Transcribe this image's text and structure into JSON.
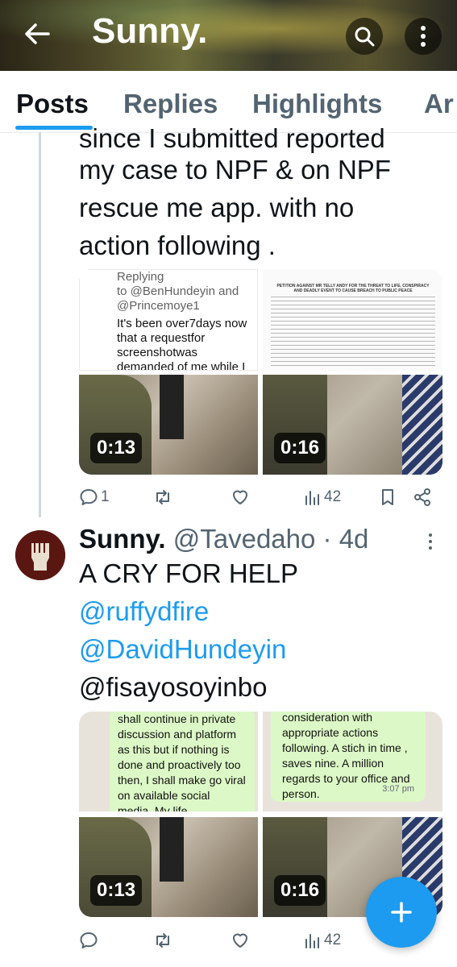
{
  "header": {
    "title": "Sunny."
  },
  "tabs": [
    {
      "label": "Posts",
      "active": true
    },
    {
      "label": "Replies"
    },
    {
      "label": "Highlights"
    },
    {
      "label": "Ar"
    }
  ],
  "post1": {
    "text_lines": [
      "since I submitted reported",
      "my case to NPF & on NPF",
      "rescue me app. with no",
      "action following ."
    ],
    "doc1": {
      "lines": [
        "Replying",
        "to @BenHundeyin and",
        "@Princemoye1",
        "It's been over7days now",
        "that a requestfor",
        "screenshotwas",
        "demanded of me while I"
      ]
    },
    "doc2": {
      "heading": "PETITION AGAINST MR TELLY ANDY FOR THE THREAT TO LIFE, CONSPIRACY AND DEADLY EVENT TO CAUSE BREACH TO PUBLIC PEACE"
    },
    "video1": {
      "duration": "0:13"
    },
    "video2": {
      "duration": "0:16"
    },
    "actions": {
      "replies": "1",
      "views": "42"
    }
  },
  "post2": {
    "name": "Sunny.",
    "handle": "@Tavedaho",
    "time": "· 4d",
    "line1": "A CRY FOR HELP",
    "mention1": "@ruffydfire",
    "mention2": "@DavidHundeyin",
    "mention3": "@fisayosoyinbo",
    "chat1": "shall continue in private discussion and platform as this but if nothing is done and proactively too then, I shall make go viral on available social media. My life",
    "chat2": "consideration with appropriate actions following.  A stich in time , saves nine.  A million regards to your office and person.",
    "chat2_time": "3:07 pm",
    "video1": {
      "duration": "0:13"
    },
    "video2": {
      "duration": "0:16"
    },
    "actions": {
      "views": "42"
    }
  },
  "colors": {
    "accent": "#1d9bf0",
    "text": "#0f1419",
    "muted": "#536471"
  },
  "icons": [
    "back-arrow-icon",
    "search-icon",
    "more-vertical-icon",
    "reply-icon",
    "repost-icon",
    "like-icon",
    "views-icon",
    "bookmark-icon",
    "share-icon",
    "plus-icon"
  ]
}
